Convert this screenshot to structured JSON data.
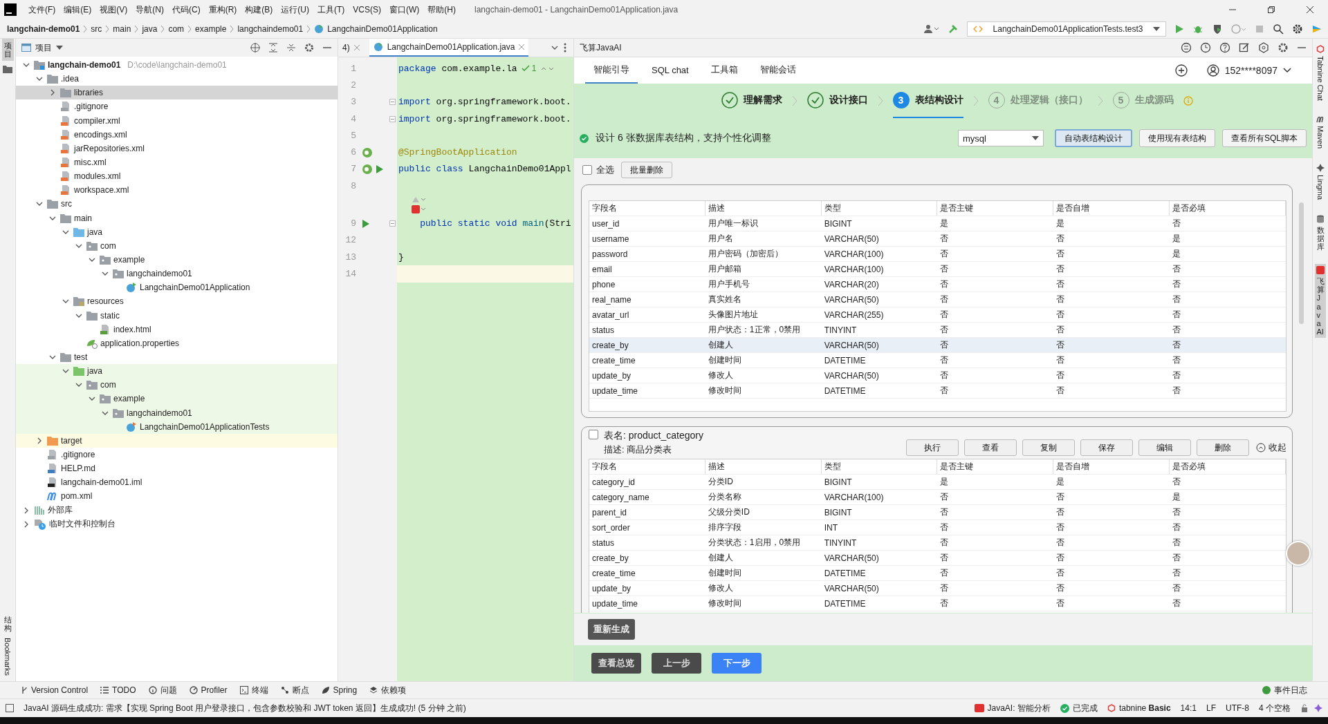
{
  "menu_bar": {
    "menus": [
      "文件(F)",
      "编辑(E)",
      "视图(V)",
      "导航(N)",
      "代码(C)",
      "重构(R)",
      "构建(B)",
      "运行(U)",
      "工具(T)",
      "VCS(S)",
      "窗口(W)",
      "帮助(H)"
    ],
    "title": "langchain-demo01 - LangchainDemo01Application.java"
  },
  "nav_bar": {
    "breadcrumbs": [
      "langchain-demo01",
      "src",
      "main",
      "java",
      "com",
      "example",
      "langchaindemo01",
      "LangchainDemo01Application"
    ],
    "run_config": "LangchainDemo01ApplicationTests.test3"
  },
  "left_strip": {
    "top": [
      {
        "label": "项目",
        "kind": "upright",
        "selected": true
      }
    ],
    "bottom": [
      {
        "label": "结构",
        "kind": "upright",
        "selected": false
      },
      {
        "label": "Bookmarks",
        "kind": "rotated",
        "selected": false
      }
    ]
  },
  "project": {
    "title": "项目",
    "tree": [
      {
        "label": "langchain-demo01",
        "hint": "D:\\code\\langchain-demo01",
        "kind": "module",
        "expanded": true,
        "selected": false,
        "children": [
          {
            "label": ".idea",
            "kind": "folder",
            "expanded": true,
            "selected": false,
            "children": [
              {
                "label": "libraries",
                "kind": "folder",
                "expanded": false,
                "selected": true
              },
              {
                "label": ".gitignore",
                "kind": "ignore",
                "selected": false
              },
              {
                "label": "compiler.xml",
                "kind": "xml",
                "selected": false
              },
              {
                "label": "encodings.xml",
                "kind": "xml",
                "selected": false
              },
              {
                "label": "jarRepositories.xml",
                "kind": "xml",
                "selected": false
              },
              {
                "label": "misc.xml",
                "kind": "xml",
                "selected": false
              },
              {
                "label": "modules.xml",
                "kind": "xml",
                "selected": false
              },
              {
                "label": "workspace.xml",
                "kind": "xml",
                "selected": false
              }
            ]
          },
          {
            "label": "src",
            "kind": "folder",
            "expanded": true,
            "selected": false,
            "children": [
              {
                "label": "main",
                "kind": "folder",
                "expanded": true,
                "selected": false,
                "children": [
                  {
                    "label": "java",
                    "kind": "source",
                    "expanded": true,
                    "selected": false,
                    "children": [
                      {
                        "label": "com",
                        "kind": "package",
                        "expanded": true,
                        "selected": false,
                        "children": [
                          {
                            "label": "example",
                            "kind": "package",
                            "expanded": true,
                            "selected": false,
                            "children": [
                              {
                                "label": "langchaindemo01",
                                "kind": "package",
                                "expanded": true,
                                "selected": false,
                                "children": [
                                  {
                                    "label": "LangchainDemo01Application",
                                    "kind": "spring-class",
                                    "selected": false
                                  }
                                ]
                              }
                            ]
                          }
                        ]
                      }
                    ]
                  },
                  {
                    "label": "resources",
                    "kind": "resources",
                    "expanded": true,
                    "selected": false,
                    "children": [
                      {
                        "label": "static",
                        "kind": "folder",
                        "expanded": true,
                        "selected": false,
                        "children": [
                          {
                            "label": "index.html",
                            "kind": "html",
                            "selected": false
                          }
                        ]
                      },
                      {
                        "label": "application.properties",
                        "kind": "properties",
                        "selected": false
                      }
                    ]
                  }
                ]
              },
              {
                "label": "test",
                "kind": "folder",
                "expanded": true,
                "selected": false,
                "children": [
                  {
                    "label": "java",
                    "kind": "test-source",
                    "expanded": true,
                    "selected": false,
                    "children": [
                      {
                        "label": "com",
                        "kind": "package",
                        "expanded": true,
                        "selected": false,
                        "children": [
                          {
                            "label": "example",
                            "kind": "package",
                            "expanded": true,
                            "selected": false,
                            "children": [
                              {
                                "label": "langchaindemo01",
                                "kind": "package",
                                "expanded": true,
                                "selected": false,
                                "children": [
                                  {
                                    "label": "LangchainDemo01ApplicationTests",
                                    "kind": "test-class",
                                    "selected": false
                                  }
                                ]
                              }
                            ]
                          }
                        ]
                      }
                    ]
                  }
                ]
              }
            ]
          },
          {
            "label": "target",
            "kind": "excluded",
            "expanded": false,
            "selected": false
          },
          {
            "label": ".gitignore",
            "kind": "ignore",
            "selected": false
          },
          {
            "label": "HELP.md",
            "kind": "md",
            "selected": false
          },
          {
            "label": "langchain-demo01.iml",
            "kind": "iml",
            "selected": false
          },
          {
            "label": "pom.xml",
            "kind": "maven",
            "selected": false
          }
        ]
      },
      {
        "label": "外部库",
        "kind": "libraries",
        "expanded": false,
        "selected": false
      },
      {
        "label": "临时文件和控制台",
        "kind": "scratches",
        "expanded": false,
        "selected": false
      }
    ]
  },
  "editor": {
    "tabs": [
      {
        "label": "4)",
        "selected": false
      },
      {
        "label": "LangchainDemo01Application.java",
        "selected": true
      }
    ],
    "inspection_count": "1",
    "lines": [
      {
        "kind": "code",
        "number": "1",
        "current": false,
        "fold": false,
        "tokens": [
          {
            "text": "package",
            "kind": "keyword"
          },
          {
            "text": " com.example.la",
            "kind": "plain"
          }
        ]
      },
      {
        "kind": "code",
        "number": "2",
        "current": false,
        "fold": false
      },
      {
        "kind": "code",
        "number": "3",
        "current": false,
        "fold": true,
        "tokens": [
          {
            "text": "import",
            "kind": "keyword"
          },
          {
            "text": " org.springframework.boot.",
            "kind": "plain"
          }
        ]
      },
      {
        "kind": "code",
        "number": "4",
        "current": false,
        "fold": true,
        "tokens": [
          {
            "text": "import",
            "kind": "keyword"
          },
          {
            "text": " org.springframework.boot.",
            "kind": "plain"
          }
        ]
      },
      {
        "kind": "code",
        "number": "5",
        "current": false,
        "fold": false
      },
      {
        "kind": "code",
        "number": "6",
        "current": false,
        "fold": false,
        "gutter": [
          {
            "kind": "spring-bean"
          }
        ],
        "tokens": [
          {
            "text": "@SpringBootApplication",
            "kind": "annotation"
          }
        ]
      },
      {
        "kind": "code",
        "number": "7",
        "current": false,
        "fold": false,
        "gutter": [
          {
            "kind": "spring-bean"
          },
          {
            "kind": "run"
          }
        ],
        "tokens": [
          {
            "text": "public class",
            "kind": "keyword"
          },
          {
            "text": " LangchainDemo01Appl",
            "kind": "plain"
          }
        ]
      },
      {
        "kind": "code",
        "number": "8",
        "current": false,
        "fold": false
      },
      {
        "kind": "inlay"
      },
      {
        "kind": "code",
        "number": "9",
        "current": false,
        "fold": true,
        "gutter": [
          {
            "kind": "run"
          }
        ],
        "tokens": [
          {
            "text": "    public static void",
            "kind": "keyword"
          },
          {
            "text": " main",
            "kind": "method"
          },
          {
            "text": "(Stri",
            "kind": "plain"
          }
        ]
      },
      {
        "kind": "code",
        "number": "12",
        "current": false,
        "fold": false
      },
      {
        "kind": "code",
        "number": "13",
        "current": false,
        "fold": false,
        "tokens": [
          {
            "text": "}",
            "kind": "plain"
          }
        ]
      },
      {
        "kind": "code",
        "number": "14",
        "current": true,
        "fold": false
      }
    ]
  },
  "ai_panel": {
    "title": "飞算JavaAI",
    "tabs": [
      {
        "label": "智能引导",
        "selected": true
      },
      {
        "label": "SQL chat",
        "selected": false
      },
      {
        "label": "工具箱",
        "selected": false
      },
      {
        "label": "智能会话",
        "selected": false
      }
    ],
    "account": "152****8097",
    "steps": [
      {
        "label": "理解需求",
        "kind": "done"
      },
      {
        "label": "设计接口",
        "kind": "done"
      },
      {
        "number": "3",
        "label": "表结构设计",
        "kind": "active"
      },
      {
        "number": "4",
        "label": "处理逻辑（接口）",
        "kind": "pending"
      },
      {
        "number": "5",
        "label": "生成源码",
        "kind": "pending"
      }
    ],
    "info": "设计 6 张数据库表结构，支持个性化调整",
    "database": "mysql",
    "actions": [
      {
        "label": "自动表结构设计",
        "selected": true
      },
      {
        "label": "使用现有表结构",
        "selected": false
      },
      {
        "label": "查看所有SQL脚本",
        "selected": false
      }
    ],
    "select_all": {
      "label": "全选",
      "checked": false
    },
    "batch_delete": "批量删除",
    "tables": [
      {
        "columns": [
          "字段名",
          "描述",
          "类型",
          "是否主键",
          "是否自增",
          "是否必填"
        ],
        "rows": [
          {
            "cells": [
              "user_id",
              "用户唯一标识",
              "BIGINT",
              "是",
              "是",
              "否"
            ],
            "selected": false
          },
          {
            "cells": [
              "username",
              "用户名",
              "VARCHAR(50)",
              "否",
              "否",
              "是"
            ],
            "selected": false
          },
          {
            "cells": [
              "password",
              "用户密码（加密后）",
              "VARCHAR(100)",
              "否",
              "否",
              "是"
            ],
            "selected": false
          },
          {
            "cells": [
              "email",
              "用户邮箱",
              "VARCHAR(100)",
              "否",
              "否",
              "否"
            ],
            "selected": false
          },
          {
            "cells": [
              "phone",
              "用户手机号",
              "VARCHAR(20)",
              "否",
              "否",
              "否"
            ],
            "selected": false
          },
          {
            "cells": [
              "real_name",
              "真实姓名",
              "VARCHAR(50)",
              "否",
              "否",
              "否"
            ],
            "selected": false
          },
          {
            "cells": [
              "avatar_url",
              "头像图片地址",
              "VARCHAR(255)",
              "否",
              "否",
              "否"
            ],
            "selected": false
          },
          {
            "cells": [
              "status",
              "用户状态：1正常，0禁用",
              "TINYINT",
              "否",
              "否",
              "否"
            ],
            "selected": false
          },
          {
            "cells": [
              "create_by",
              "创建人",
              "VARCHAR(50)",
              "否",
              "否",
              "否"
            ],
            "selected": true
          },
          {
            "cells": [
              "create_time",
              "创建时间",
              "DATETIME",
              "否",
              "否",
              "否"
            ],
            "selected": false
          },
          {
            "cells": [
              "update_by",
              "修改人",
              "VARCHAR(50)",
              "否",
              "否",
              "否"
            ],
            "selected": false
          },
          {
            "cells": [
              "update_time",
              "修改时间",
              "DATETIME",
              "否",
              "否",
              "否"
            ],
            "selected": false
          }
        ]
      },
      {
        "checked": false,
        "name": "表名: product_category",
        "description": "描述: 商品分类表",
        "buttons": [
          "执行",
          "查看",
          "复制",
          "保存",
          "编辑",
          "删除"
        ],
        "collapse": "收起",
        "columns": [
          "字段名",
          "描述",
          "类型",
          "是否主键",
          "是否自增",
          "是否必填"
        ],
        "rows": [
          {
            "cells": [
              "category_id",
              "分类ID",
              "BIGINT",
              "是",
              "是",
              "否"
            ],
            "selected": false
          },
          {
            "cells": [
              "category_name",
              "分类名称",
              "VARCHAR(100)",
              "否",
              "否",
              "是"
            ],
            "selected": false
          },
          {
            "cells": [
              "parent_id",
              "父级分类ID",
              "BIGINT",
              "否",
              "否",
              "否"
            ],
            "selected": false
          },
          {
            "cells": [
              "sort_order",
              "排序字段",
              "INT",
              "否",
              "否",
              "否"
            ],
            "selected": false
          },
          {
            "cells": [
              "status",
              "分类状态：1启用，0禁用",
              "TINYINT",
              "否",
              "否",
              "否"
            ],
            "selected": false
          },
          {
            "cells": [
              "create_by",
              "创建人",
              "VARCHAR(50)",
              "否",
              "否",
              "否"
            ],
            "selected": false
          },
          {
            "cells": [
              "create_time",
              "创建时间",
              "DATETIME",
              "否",
              "否",
              "否"
            ],
            "selected": false
          },
          {
            "cells": [
              "update_by",
              "修改人",
              "VARCHAR(50)",
              "否",
              "否",
              "否"
            ],
            "selected": false
          },
          {
            "cells": [
              "update_time",
              "修改时间",
              "DATETIME",
              "否",
              "否",
              "否"
            ],
            "selected": false
          }
        ]
      }
    ],
    "regenerate": "重新生成",
    "footer": [
      {
        "label": "查看总览",
        "kind": "dark"
      },
      {
        "label": "上一步",
        "kind": "dark"
      },
      {
        "label": "下一步",
        "kind": "primary"
      }
    ]
  },
  "right_strip": [
    {
      "label": "Tabnine Chat",
      "kind": "rotated",
      "selected": false
    },
    {
      "label": "Maven",
      "kind": "rotated",
      "selected": false
    },
    {
      "label": "Lingma",
      "kind": "rotated",
      "selected": false
    },
    {
      "label": "数据库",
      "kind": "upright",
      "selected": false
    },
    {
      "label": "飞算JavaAI",
      "kind": "upright",
      "selected": true
    }
  ],
  "tool_bar": {
    "items": [
      {
        "label": "Version Control",
        "kind": "vcs"
      },
      {
        "label": "TODO",
        "kind": "todo"
      },
      {
        "label": "问题",
        "kind": "problems"
      },
      {
        "label": "Profiler",
        "kind": "profiler"
      },
      {
        "label": "终端",
        "kind": "terminal"
      },
      {
        "label": "断点",
        "kind": "breakpoints"
      },
      {
        "label": "Spring",
        "kind": "spring"
      },
      {
        "label": "依赖项",
        "kind": "deps"
      }
    ],
    "event_log": "事件日志"
  },
  "status_bar": {
    "message": "JavaAI 源码生成成功: 需求【实现 Spring Boot 用户登录接口，包含参数校验和 JWT token 返回】生成成功! (5 分钟 之前)",
    "items": [
      {
        "label": "JavaAI: 智能分析",
        "kind": "ai"
      },
      {
        "label": "已完成",
        "kind": "done"
      },
      {
        "label": "tabnine **Basic**",
        "kind": "tabnine"
      },
      {
        "label": "14:1",
        "kind": "plain"
      },
      {
        "label": "LF",
        "kind": "plain"
      },
      {
        "label": "UTF-8",
        "kind": "plain"
      },
      {
        "label": "4 个空格",
        "kind": "plain"
      }
    ]
  }
}
